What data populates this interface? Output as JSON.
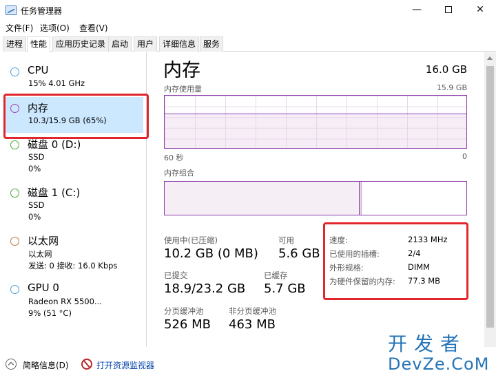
{
  "window": {
    "title": "任务管理器",
    "min": "—",
    "close": "✕"
  },
  "menu": [
    "文件(F)",
    "选项(O)",
    "查看(V)"
  ],
  "tabs": [
    "进程",
    "性能",
    "应用历史记录",
    "启动",
    "用户",
    "详细信息",
    "服务"
  ],
  "active_tab": "性能",
  "sidebar": [
    {
      "title": "CPU",
      "sub": [
        "15%  4.01 GHz"
      ],
      "color": "#4a9ed8"
    },
    {
      "title": "内存",
      "sub": [
        "10.3/15.9 GB (65%)"
      ],
      "color": "#a03fb0"
    },
    {
      "title": "磁盘 0 (D:)",
      "sub": [
        "SSD",
        "0%"
      ],
      "color": "#4aa534"
    },
    {
      "title": "磁盘 1 (C:)",
      "sub": [
        "SSD",
        "0%"
      ],
      "color": "#4aa534"
    },
    {
      "title": "以太网",
      "sub": [
        "以太网",
        "发送: 0  接收: 16.0 Kbps"
      ],
      "color": "#b87a3b"
    },
    {
      "title": "GPU 0",
      "sub": [
        "Radeon RX 5500...",
        "9% (51 °C)"
      ],
      "color": "#4a9ed8"
    }
  ],
  "main": {
    "title": "内存",
    "total": "16.0 GB",
    "usage_label": "内存使用量",
    "usage_max": "15.9 GB",
    "time_left": "60 秒",
    "time_right": "0",
    "composition_label": "内存组合",
    "stats": {
      "in_use_label": "使用中(已压缩)",
      "in_use": "10.2 GB (0 MB)",
      "available_label": "可用",
      "available": "5.6 GB",
      "committed_label": "已提交",
      "committed": "18.9/23.2 GB",
      "cached_label": "已缓存",
      "cached": "5.7 GB",
      "paged_label": "分页缓冲池",
      "paged": "526 MB",
      "nonpaged_label": "非分页缓冲池",
      "nonpaged": "463 MB"
    },
    "props": [
      {
        "label": "速度:",
        "value": "2133 MHz"
      },
      {
        "label": "已使用的插槽:",
        "value": "2/4"
      },
      {
        "label": "外形规格:",
        "value": "DIMM"
      },
      {
        "label": "为硬件保留的内存:",
        "value": "77.3 MB"
      }
    ]
  },
  "bottom": {
    "summary": "简略信息(D)",
    "monitor": "打开资源监视器"
  },
  "watermark": {
    "line1": "开发者",
    "line2": "DevZe.CoM"
  }
}
